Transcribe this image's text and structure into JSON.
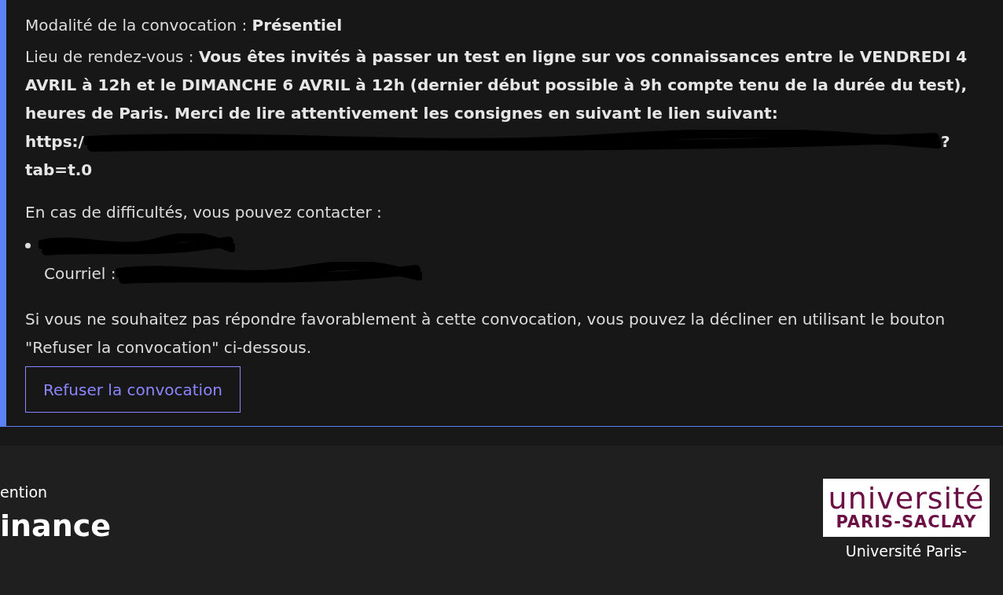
{
  "convocation": {
    "modality": {
      "label": "Modalité de la convocation : ",
      "value": "Présentiel"
    },
    "place": {
      "label": "Lieu de rendez-vous : ",
      "value": "Vous êtes invités à passer un test en ligne sur vos connaissances entre le VENDREDI 4 AVRIL à 12h et le DIMANCHE 6 AVRIL à 12h (dernier début possible à 9h compte tenu de la durée du test), heures de Paris. Merci de lire attentivement les consignes en suivant le lien suivant:",
      "url_start": "https:/",
      "url_end": "?",
      "url_tail": "tab=t.0"
    },
    "contact_intro": "En cas de difficultés, vous pouvez contacter :",
    "contacts": [
      {
        "email_label": "Courriel :"
      }
    ],
    "decline_text": "Si vous ne souhaitez pas répondre favorablement à cette convocation, vous pouvez la décliner en utilisant le bouton \"Refuser la convocation\" ci-dessous.",
    "decline_button": "Refuser la convocation"
  },
  "footer": {
    "eyebrow": "ention",
    "title": "inance",
    "logo": {
      "line_1": "université",
      "line_2": "PARIS-SACLAY"
    },
    "caption": "Université Paris-"
  }
}
